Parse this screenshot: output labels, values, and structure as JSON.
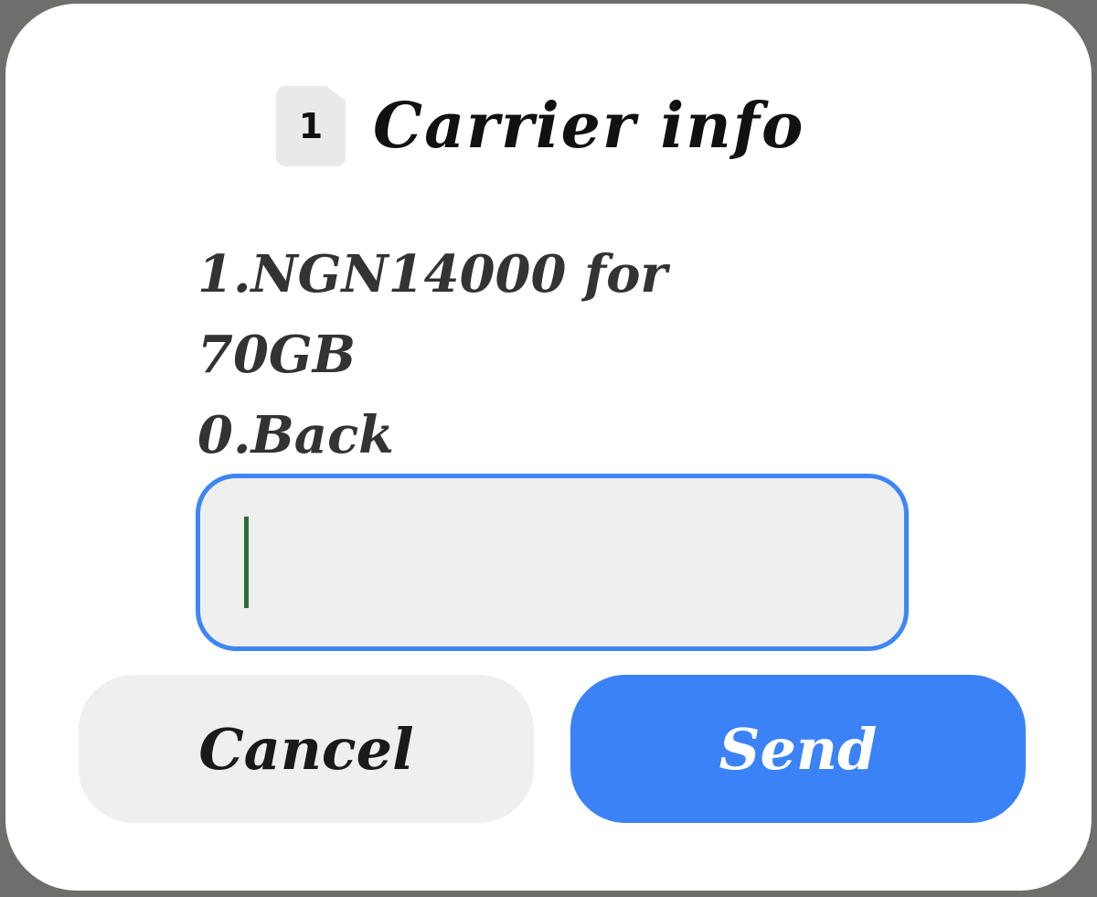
{
  "dialog": {
    "sim_icon_label": "1",
    "title": "Carrier info",
    "message_lines": [
      "1.NGN14000 for",
      "70GB",
      "0.Back"
    ],
    "input": {
      "value": ""
    },
    "buttons": {
      "cancel_label": "Cancel",
      "send_label": "Send"
    }
  },
  "colors": {
    "accent": "#3b82f6",
    "input_border": "#3d86f5",
    "caret": "#2e6b33",
    "backdrop": "#6e6f6d"
  }
}
